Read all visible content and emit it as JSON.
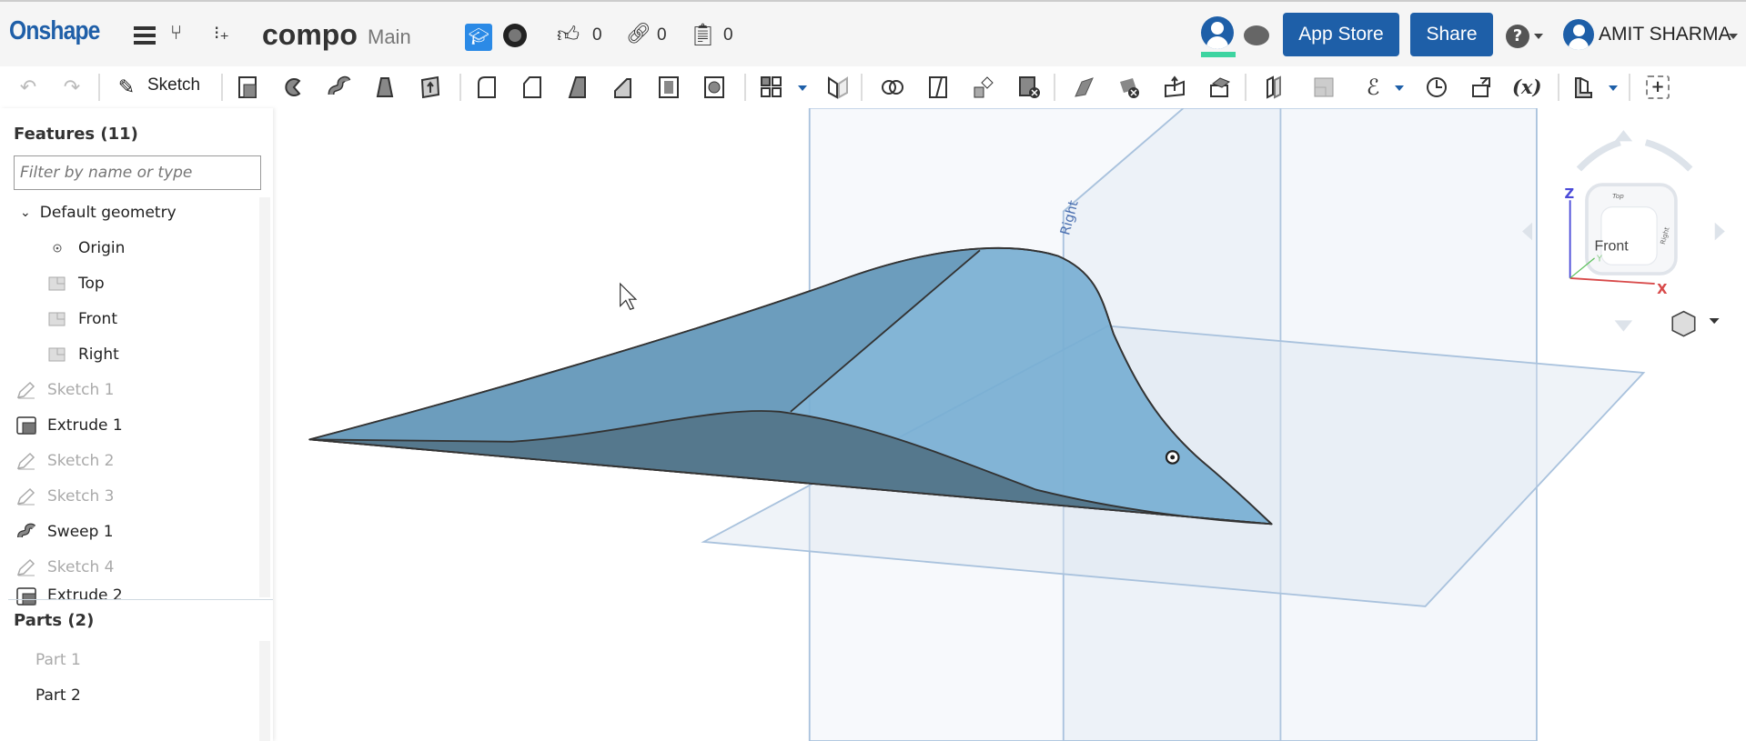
{
  "header": {
    "logo": "Onshape",
    "document_title": "compo",
    "branch": "Main",
    "likes": "0",
    "links": "0",
    "copies": "0",
    "app_store_label": "App Store",
    "share_label": "Share",
    "user_name": "AMIT SHARMA",
    "presence_color": "#3dd4a0",
    "brand_color": "#1e5fa8"
  },
  "toolbar": {
    "sketch_label": "Sketch",
    "variable_label": "(x)"
  },
  "features": {
    "title": "Features (11)",
    "filter_placeholder": "Filter by name or type",
    "group": "Default geometry",
    "items": [
      {
        "label": "Origin",
        "icon": "origin-icon",
        "state": "normal"
      },
      {
        "label": "Top",
        "icon": "plane-icon",
        "state": "normal"
      },
      {
        "label": "Front",
        "icon": "plane-icon",
        "state": "normal"
      },
      {
        "label": "Right",
        "icon": "plane-icon",
        "state": "normal"
      },
      {
        "label": "Sketch 1",
        "icon": "sketch-icon",
        "state": "hidden"
      },
      {
        "label": "Extrude 1",
        "icon": "extrude-icon",
        "state": "normal"
      },
      {
        "label": "Sketch 2",
        "icon": "sketch-icon",
        "state": "hidden"
      },
      {
        "label": "Sketch 3",
        "icon": "sketch-icon",
        "state": "hidden"
      },
      {
        "label": "Sweep 1",
        "icon": "sweep-icon",
        "state": "normal"
      },
      {
        "label": "Sketch 4",
        "icon": "sketch-icon",
        "state": "hidden"
      },
      {
        "label": "Extrude 2",
        "icon": "extrude-icon",
        "state": "normal"
      }
    ]
  },
  "parts": {
    "title": "Parts (2)",
    "items": [
      {
        "label": "Part 1",
        "state": "hidden"
      },
      {
        "label": "Part 2",
        "state": "normal"
      }
    ]
  },
  "viewport": {
    "plane_label": "Right",
    "viewcube": {
      "front": "Front",
      "top": "Top",
      "right": "Right",
      "axis_x": "X",
      "axis_y": "Y",
      "axis_z": "Z"
    }
  }
}
